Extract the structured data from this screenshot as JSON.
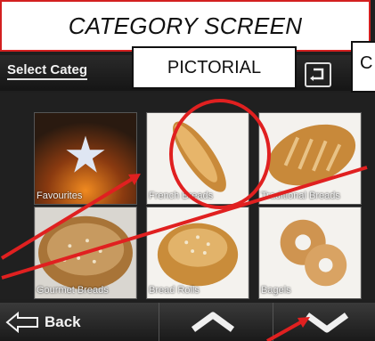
{
  "caption": {
    "title": "CATEGORY SCREEN",
    "mode_label": "PICTORIAL",
    "clipped_label": "C"
  },
  "header": {
    "select_label": "Select Categ"
  },
  "categories": [
    {
      "label": "Favourites"
    },
    {
      "label": "French Breads"
    },
    {
      "label": "Traditional Breads"
    },
    {
      "label": "Gourmet Breads"
    },
    {
      "label": "Bread Rolls"
    },
    {
      "label": "Bagels"
    }
  ],
  "footer": {
    "back_label": "Back"
  },
  "colors": {
    "annotation": "#e02020",
    "panel": "#1f1f1f"
  },
  "icons": {
    "undo": "undo-arrow-icon",
    "up": "chevron-up-icon",
    "down": "chevron-down-icon",
    "back": "back-arrow-icon"
  }
}
